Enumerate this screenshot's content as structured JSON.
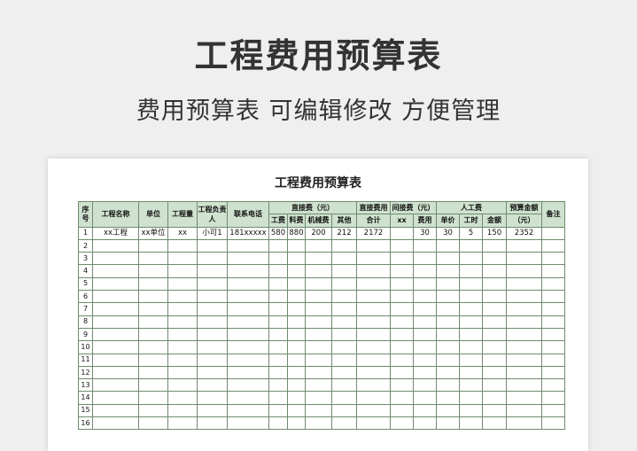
{
  "banner": {
    "title": "工程费用预算表",
    "subtitle": "费用预算表 可编辑修改 方便管理"
  },
  "sheet": {
    "title": "工程费用预算表",
    "headers": {
      "seq": "序号",
      "project_name": "工程名称",
      "unit": "单位",
      "quantity": "工程量",
      "manager": "工程负责人",
      "phone": "联系电话",
      "direct_cost": "直接费（元）",
      "direct_labor": "工费",
      "direct_material": "料费",
      "direct_machine": "机械费",
      "direct_other": "其他",
      "direct_total_top": "直接费用",
      "direct_total_bottom": "合计",
      "indirect_cost": "间接费（元）",
      "indirect_xx": "xx",
      "indirect_fee": "费用",
      "labor_cost": "人工费",
      "labor_price": "单价",
      "labor_hours": "工时",
      "labor_amount": "金额",
      "budget_top": "预算金额",
      "budget_bottom": "（元）",
      "remark": "备注"
    },
    "rows": [
      [
        "1",
        "xx工程",
        "xx单位",
        "xx",
        "小可1",
        "181xxxxx",
        "580",
        "880",
        "200",
        "212",
        "2172",
        "",
        "30",
        "30",
        "5",
        "150",
        "2352",
        ""
      ],
      [
        "2",
        "",
        "",
        "",
        "",
        "",
        "",
        "",
        "",
        "",
        "",
        "",
        "",
        "",
        "",
        "",
        "",
        ""
      ],
      [
        "3",
        "",
        "",
        "",
        "",
        "",
        "",
        "",
        "",
        "",
        "",
        "",
        "",
        "",
        "",
        "",
        "",
        ""
      ],
      [
        "4",
        "",
        "",
        "",
        "",
        "",
        "",
        "",
        "",
        "",
        "",
        "",
        "",
        "",
        "",
        "",
        "",
        ""
      ],
      [
        "5",
        "",
        "",
        "",
        "",
        "",
        "",
        "",
        "",
        "",
        "",
        "",
        "",
        "",
        "",
        "",
        "",
        ""
      ],
      [
        "6",
        "",
        "",
        "",
        "",
        "",
        "",
        "",
        "",
        "",
        "",
        "",
        "",
        "",
        "",
        "",
        "",
        ""
      ],
      [
        "7",
        "",
        "",
        "",
        "",
        "",
        "",
        "",
        "",
        "",
        "",
        "",
        "",
        "",
        "",
        "",
        "",
        ""
      ],
      [
        "8",
        "",
        "",
        "",
        "",
        "",
        "",
        "",
        "",
        "",
        "",
        "",
        "",
        "",
        "",
        "",
        "",
        ""
      ],
      [
        "9",
        "",
        "",
        "",
        "",
        "",
        "",
        "",
        "",
        "",
        "",
        "",
        "",
        "",
        "",
        "",
        "",
        ""
      ],
      [
        "10",
        "",
        "",
        "",
        "",
        "",
        "",
        "",
        "",
        "",
        "",
        "",
        "",
        "",
        "",
        "",
        "",
        ""
      ],
      [
        "11",
        "",
        "",
        "",
        "",
        "",
        "",
        "",
        "",
        "",
        "",
        "",
        "",
        "",
        "",
        "",
        "",
        ""
      ],
      [
        "12",
        "",
        "",
        "",
        "",
        "",
        "",
        "",
        "",
        "",
        "",
        "",
        "",
        "",
        "",
        "",
        "",
        ""
      ],
      [
        "13",
        "",
        "",
        "",
        "",
        "",
        "",
        "",
        "",
        "",
        "",
        "",
        "",
        "",
        "",
        "",
        "",
        ""
      ],
      [
        "14",
        "",
        "",
        "",
        "",
        "",
        "",
        "",
        "",
        "",
        "",
        "",
        "",
        "",
        "",
        "",
        "",
        ""
      ],
      [
        "15",
        "",
        "",
        "",
        "",
        "",
        "",
        "",
        "",
        "",
        "",
        "",
        "",
        "",
        "",
        "",
        "",
        ""
      ],
      [
        "16",
        "",
        "",
        "",
        "",
        "",
        "",
        "",
        "",
        "",
        "",
        "",
        "",
        "",
        "",
        "",
        "",
        ""
      ]
    ]
  },
  "colors": {
    "header_bg": "#cfe2cf",
    "grid_line": "#6f8a6f"
  }
}
